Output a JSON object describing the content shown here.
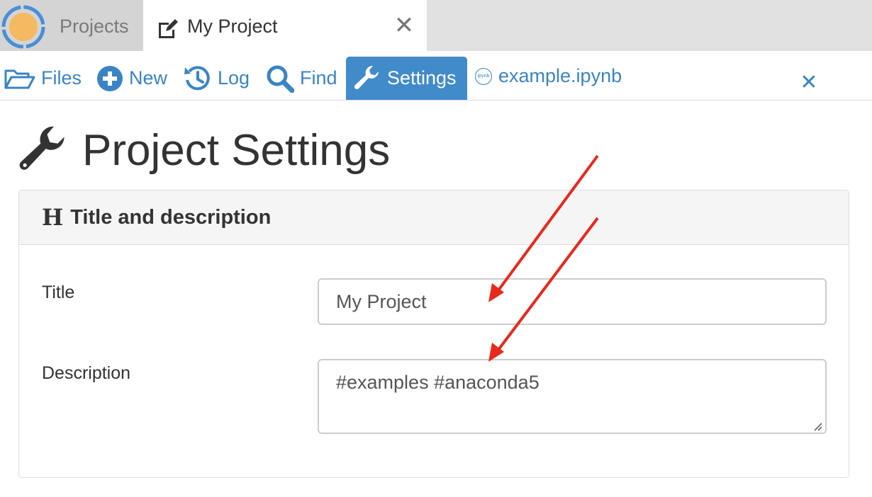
{
  "tabs": {
    "projects_label": "Projects",
    "project_label": "My Project",
    "close_glyph": "✕"
  },
  "nav": {
    "files": "Files",
    "new": "New",
    "log": "Log",
    "find": "Find",
    "settings": "Settings",
    "file_tab": "example.ipynb",
    "file_icon_text": "ipynb",
    "close_glyph": "✕"
  },
  "page": {
    "title": "Project Settings"
  },
  "panel": {
    "heading_icon": "H",
    "heading": "Title and description",
    "title_label": "Title",
    "title_value": "My Project",
    "description_label": "Description",
    "description_value": "#examples #anaconda5"
  },
  "colors": {
    "accent": "#428bca",
    "link": "#3a84c5",
    "annotation_arrow": "#e8291c",
    "logo_orange": "#f5b961",
    "logo_blue": "#4a8ed6"
  },
  "icons": [
    "logo-icon",
    "edit-icon",
    "close-icon",
    "folder-open-icon",
    "plus-circle-icon",
    "history-icon",
    "search-icon",
    "wrench-icon",
    "ipynb-icon",
    "header-icon",
    "resize-grip-icon"
  ]
}
